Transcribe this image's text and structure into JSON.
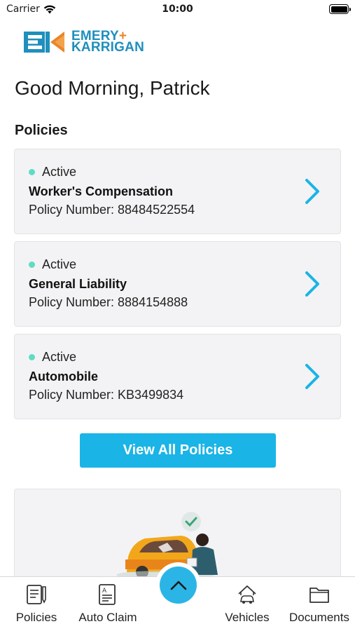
{
  "status_bar": {
    "carrier": "Carrier",
    "time": "10:00"
  },
  "brand": {
    "line1": "EMERY",
    "plus": "+",
    "line2": "KARRIGAN",
    "primary_color": "#1f8fbd",
    "accent_color": "#e9852b"
  },
  "greeting": "Good Morning, Patrick",
  "policies_section": {
    "title": "Policies",
    "items": [
      {
        "status": "Active",
        "name": "Worker's Compensation",
        "number": "Policy Number: 88484522554"
      },
      {
        "status": "Active",
        "name": "General Liability",
        "number": "Policy Number: 8884154888"
      },
      {
        "status": "Active",
        "name": "Automobile",
        "number": "Policy Number: KB3499834"
      }
    ],
    "view_all_label": "View All Policies"
  },
  "tab_bar": {
    "items": [
      {
        "label": "Policies",
        "icon": "policies-document-icon"
      },
      {
        "label": "Auto Claim",
        "icon": "auto-claim-icon"
      },
      {
        "label": "",
        "icon": "chevron-up-icon"
      },
      {
        "label": "Vehicles",
        "icon": "vehicle-home-icon"
      },
      {
        "label": "Documents",
        "icon": "folder-icon"
      }
    ]
  },
  "colors": {
    "status_active": "#5fdcc4",
    "button": "#1ab4e6",
    "chevron": "#1ab4e6"
  }
}
